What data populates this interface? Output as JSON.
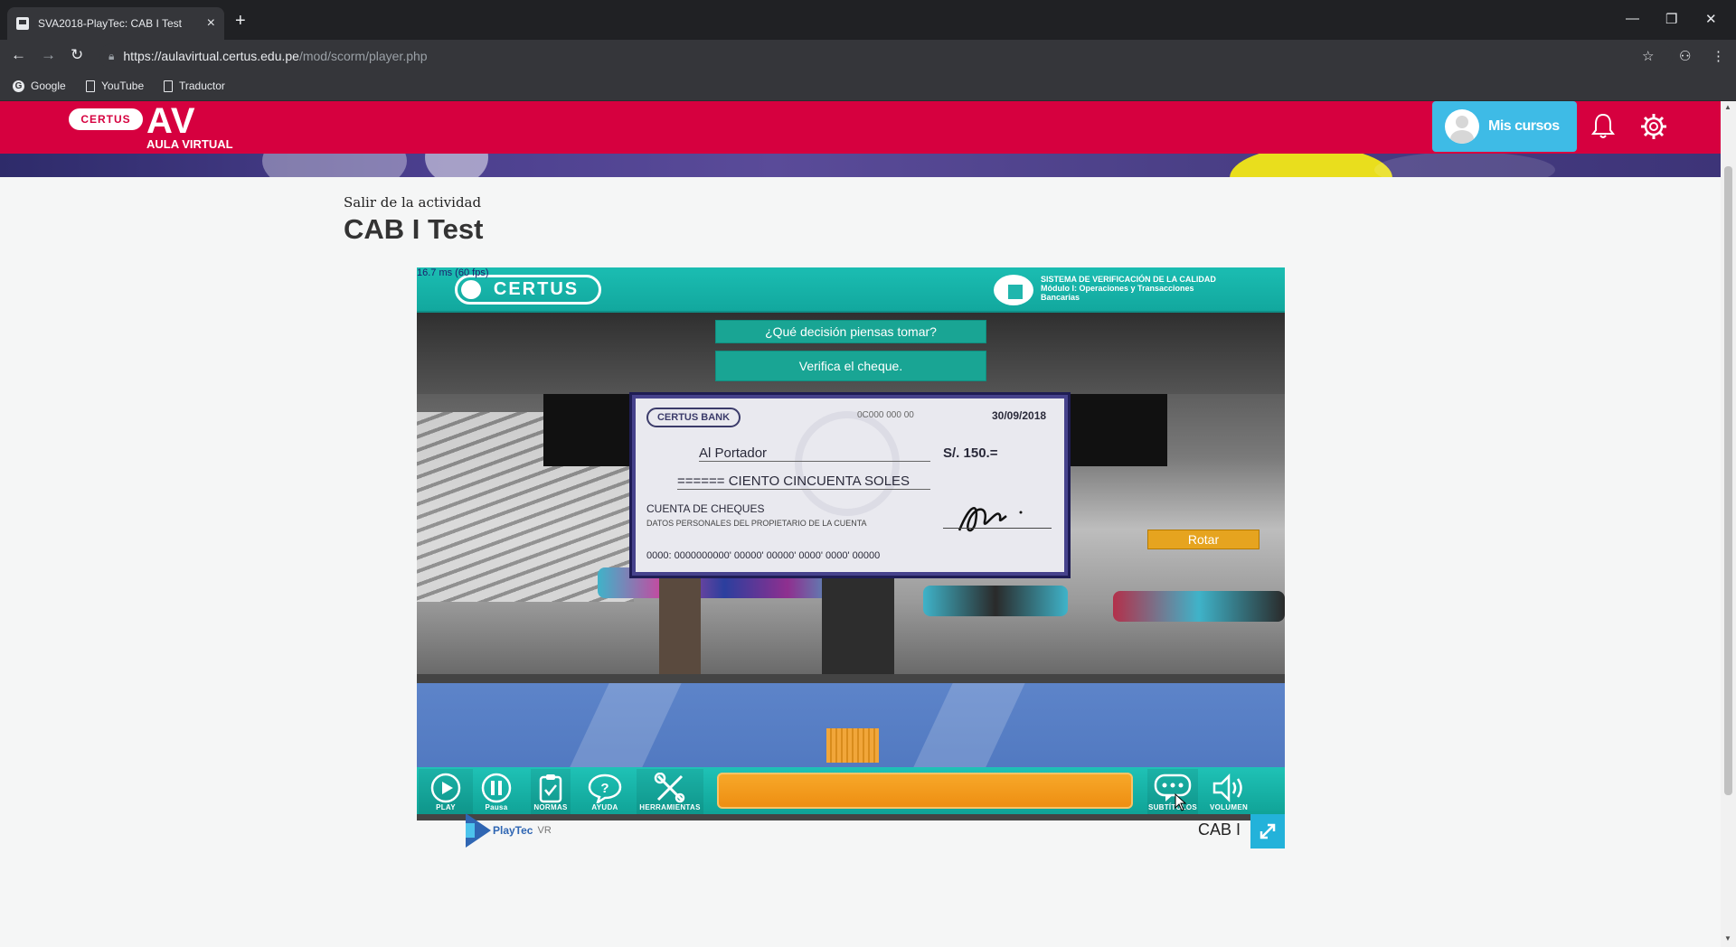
{
  "browser": {
    "tab_title": "SVA2018-PlayTec: CAB I Test",
    "tab_close": "×",
    "new_tab": "+",
    "url_host": "https://aulavirtual.certus.edu.pe",
    "url_path": "/mod/scorm/player.php",
    "window_min": "—",
    "window_restore": "❐",
    "window_close": "✕",
    "bookmarks": [
      "Google",
      "YouTube",
      "Traductor"
    ]
  },
  "header": {
    "logo_pill": "CERTUS",
    "logo_av": "AV",
    "logo_subtitle": "AULA VIRTUAL",
    "my_courses": "Mis cursos"
  },
  "page": {
    "exit_link": "Salir de la actividad",
    "title": "CAB I Test"
  },
  "game": {
    "fps_readout": "16.7 ms (60 fps)",
    "brand": "CERTUS",
    "system_line1": "SISTEMA DE VERIFICACIÓN DE LA CALIDAD",
    "system_line2": "Módulo I: Operaciones y Transacciones",
    "system_line3": "Bancarias",
    "question": "¿Qué decisión piensas tomar?",
    "option": "Verifica el cheque.",
    "rotate_button": "Rotar",
    "cheque": {
      "bank": "CERTUS BANK",
      "number": "0C000 000 00",
      "date": "30/09/2018",
      "payee": "Al Portador",
      "amount": "S/. 150.=",
      "amount_words": "====== CIENTO CINCUENTA SOLES",
      "account_type": "CUENTA DE CHEQUES",
      "owner_data": "DATOS PERSONALES DEL PROPIETARIO DE LA CUENTA",
      "micr": "0000: 0000000000' 00000' 00000' 0000' 0000' 00000"
    },
    "controls": {
      "play": "PLAY",
      "pause": "Pausa",
      "rules": "NORMAS",
      "help": "AYUDA",
      "tools": "HERRAMIENTAS",
      "subtitles": "SUBTÍTULOS",
      "volume": "VOLUMEN"
    }
  },
  "footer": {
    "playtec": "PlayTec",
    "playtec_vr": "VR",
    "activity_name": "CAB I"
  },
  "colors": {
    "brand_red": "#d6003f",
    "teal": "#19a594",
    "orange": "#e6a41f",
    "light_blue": "#3ebbe6"
  }
}
